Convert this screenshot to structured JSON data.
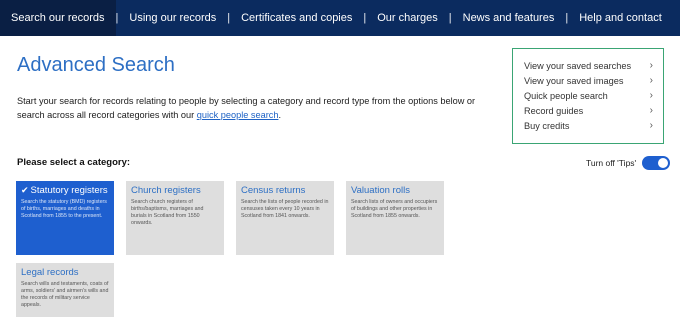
{
  "nav": {
    "items": [
      {
        "label": "Search our records",
        "active": true
      },
      {
        "label": "Using our records"
      },
      {
        "label": "Certificates and copies"
      },
      {
        "label": "Our charges"
      },
      {
        "label": "News and features"
      },
      {
        "label": "Help and contact"
      }
    ],
    "separator": "|"
  },
  "page": {
    "title": "Advanced Search",
    "intro_text": "Start your search for records relating to people by selecting a category and record type from the options below or search across all record categories with our ",
    "intro_link": "quick people search",
    "intro_end": "."
  },
  "sidebar": {
    "links": [
      {
        "label": "View your saved searches"
      },
      {
        "label": "View your saved images"
      },
      {
        "label": "Quick people search"
      },
      {
        "label": "Record guides"
      },
      {
        "label": "Buy credits"
      }
    ],
    "chevron": "›"
  },
  "categories": {
    "prompt": "Please select a category:",
    "tips_label": "Turn off 'Tips'",
    "cards": [
      {
        "title": "Statutory registers",
        "desc": "Search the statutory (BMD) registers of births, marriages and deaths in Scotland from 1855 to the present.",
        "selected": true
      },
      {
        "title": "Church registers",
        "desc": "Search church registers of births/baptisms, marriages and burials in Scotland from 1550 onwards."
      },
      {
        "title": "Census returns",
        "desc": "Search the lists of people recorded in censuses taken every 10 years in Scotland from 1841 onwards."
      },
      {
        "title": "Valuation rolls",
        "desc": "Search lists of owners and occupiers of buildings and other properties in Scotland from 1855 onwards."
      },
      {
        "title": "Legal records",
        "desc": "Search wills and testaments, coats of arms, soldiers' and airmen's wills and the records of military service appeals."
      }
    ]
  },
  "colors": {
    "nav_bg": "#0b2b5f",
    "accent_blue": "#1e5fcf",
    "title_blue": "#2d6fc4",
    "sidebar_border": "#3aa574",
    "card_bg": "#dedede"
  }
}
